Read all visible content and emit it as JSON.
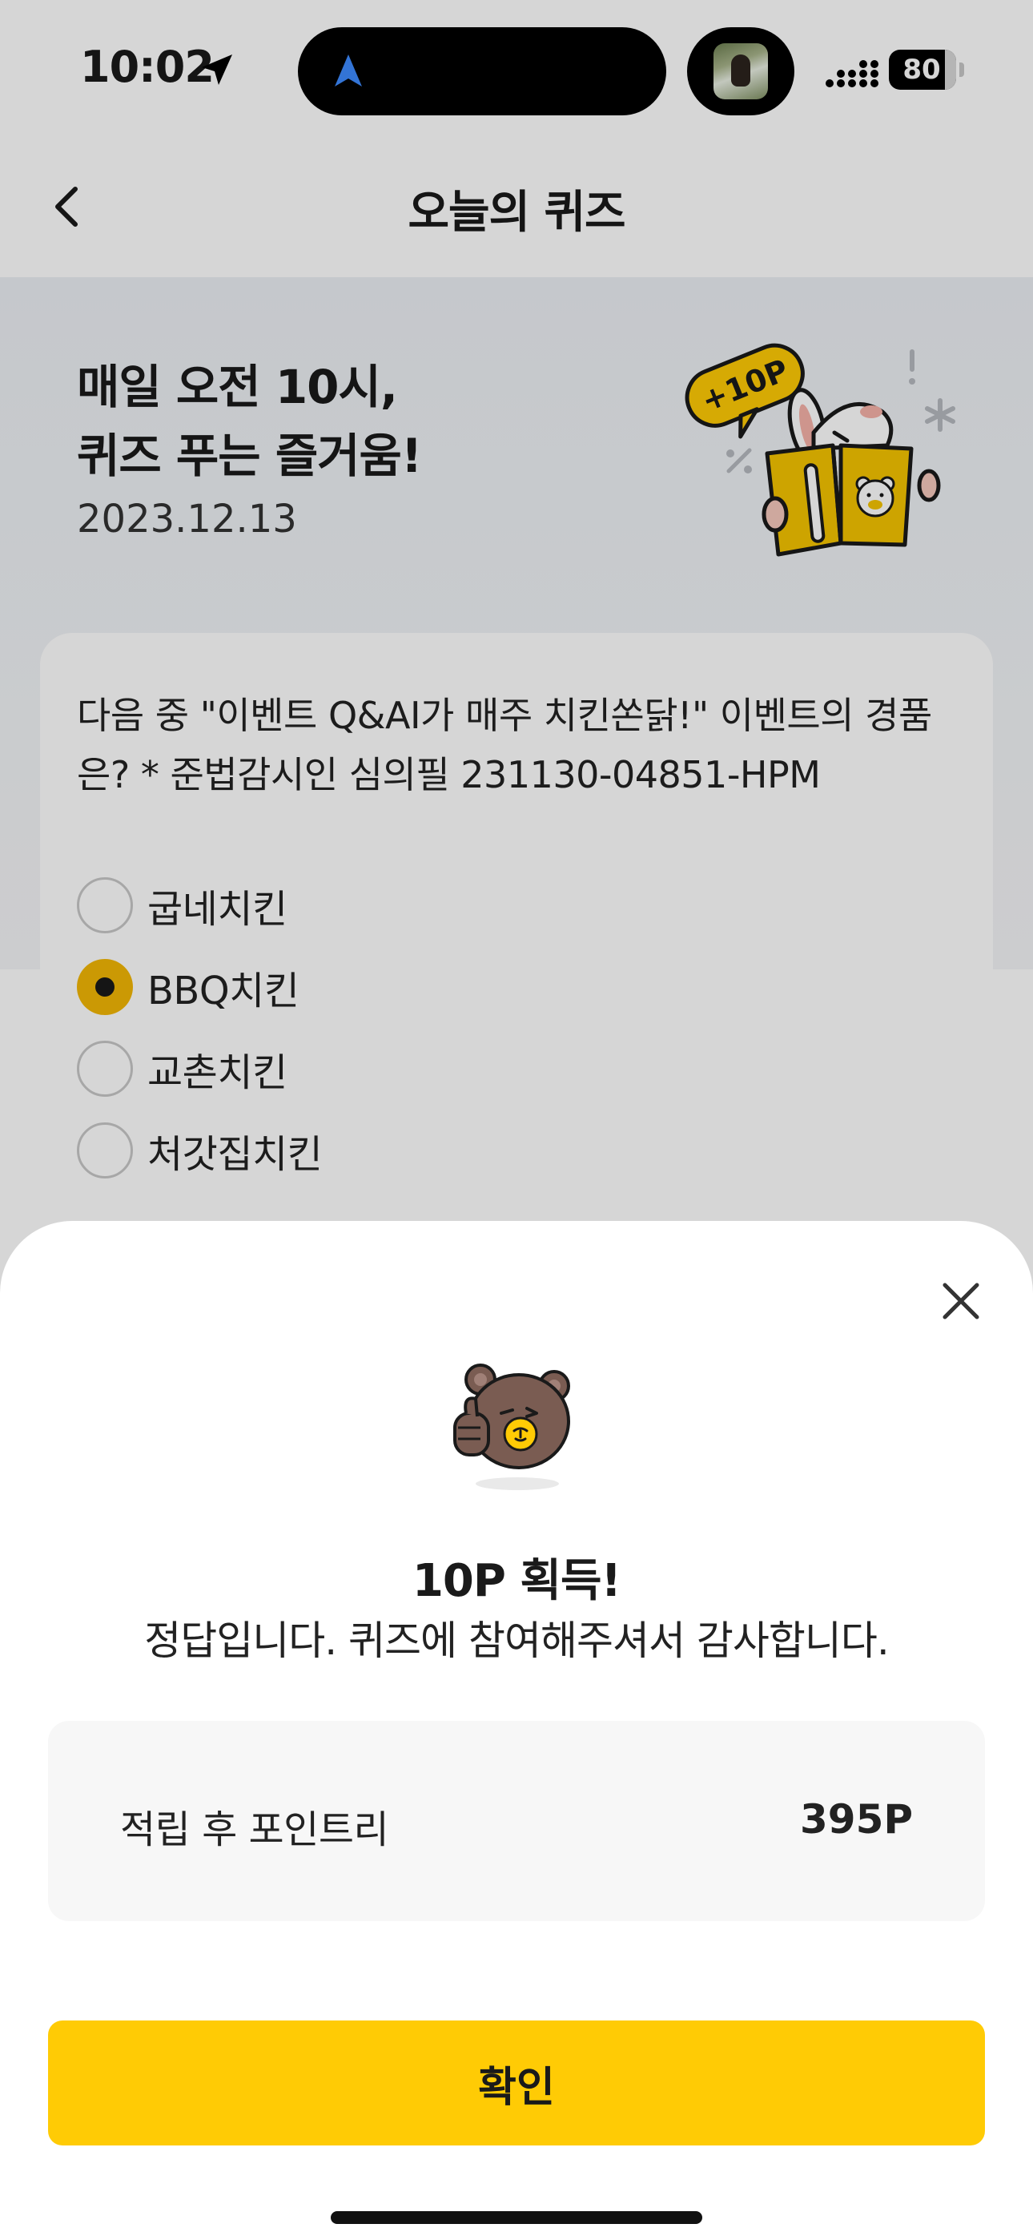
{
  "status_bar": {
    "time": "10:02",
    "battery_percent": "80",
    "icons": [
      "location-arrow-icon",
      "navigation-icon",
      "profile-photo",
      "signal-icon",
      "battery-icon"
    ]
  },
  "nav": {
    "title": "오늘의 퀴즈",
    "back_icon": "chevron-left-icon"
  },
  "hero": {
    "heading_line1": "매일 오전 10시,",
    "heading_line2": "퀴즈 푸는 즐거움!",
    "date": "2023.12.13",
    "illustration_badge": "+10P"
  },
  "quiz": {
    "question": "다음 중 \"이벤트 Q&AI가 매주 치킨쏜닭!\" 이벤트의 경품은? * 준법감시인 심의필 231130-04851-HPM",
    "options": [
      {
        "label": "굽네치킨",
        "selected": false
      },
      {
        "label": "BBQ치킨",
        "selected": true
      },
      {
        "label": "교촌치킨",
        "selected": false
      },
      {
        "label": "처갓집치킨",
        "selected": false
      }
    ]
  },
  "result_sheet": {
    "title": "10P 획득!",
    "message": "정답입니다. 퀴즈에 참여해주셔서 감사합니다.",
    "points_label": "적립 후 포인트리",
    "points_value": "395P",
    "confirm_label": "확인",
    "close_icon": "close-icon"
  },
  "colors": {
    "accent_yellow": "#ffcb05",
    "radio_selected": "#f2b705",
    "hero_bg": "#ebeff4",
    "points_box_bg": "#f7f7f7"
  }
}
